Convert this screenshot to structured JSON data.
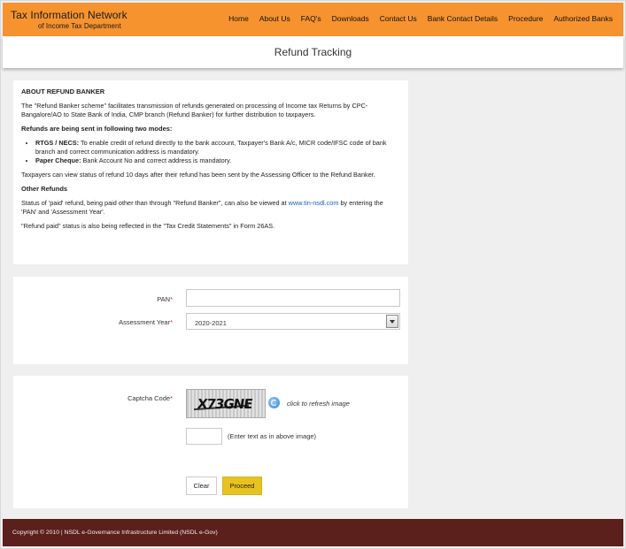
{
  "header": {
    "title": "Tax Information Network",
    "subtitle": "of Income Tax Department",
    "nav": [
      "Home",
      "About Us",
      "FAQ's",
      "Downloads",
      "Contact Us",
      "Bank Contact Details",
      "Procedure",
      "Authorized Banks"
    ]
  },
  "page_title": "Refund Tracking",
  "info": {
    "heading": "ABOUT REFUND BANKER",
    "intro": "The \"Refund Banker scheme\" facilitates transmission of refunds generated on processing of Income tax Returns by CPC-Bangalore/AO to State Bank of India, CMP branch (Refund Banker) for further distribution to taxpayers.",
    "modes_heading": "Refunds are being sent in following two modes:",
    "mode1_label": "RTGS / NECS:",
    "mode1_text": " To enable credit of refund directly to the bank account, Taxpayer's Bank A/c, MICR code/IFSC code of bank branch and correct communication address is mandatory.",
    "mode2_label": "Paper Cheque:",
    "mode2_text": " Bank Account No and correct address is mandatory.",
    "view_status": "Taxpayers can view status of refund 10 days after their refund has been sent by the Assessing Officer to the Refund Banker.",
    "other_heading": "Other Refunds",
    "other_text_before": "Status of 'paid' refund, being paid other than through \"Refund Banker\", can also be viewed at ",
    "other_link": "www.tin-nsdl.com",
    "other_text_after": " by entering the 'PAN' and 'Assessment Year'.",
    "refund_paid_note": "\"Refund paid\" status is also being reflected in the \"Tax Credit Statements\" in Form 26AS."
  },
  "form": {
    "pan_label": "PAN",
    "pan_value": "",
    "ay_label": "Assessment Year",
    "ay_selected": "2020-2021",
    "required_mark": "*",
    "captcha_label": "Captcha Code",
    "captcha_text": "X73GNE",
    "refresh_text": "click to refresh image",
    "captcha_value": "",
    "captcha_hint": "(Enter text as in above image)",
    "clear_label": "Clear",
    "proceed_label": "Proceed"
  },
  "footer": {
    "text": "Copyright © 2010 | NSDL e-Governance Infrastructure Limited (NSDL e-Gov)"
  }
}
